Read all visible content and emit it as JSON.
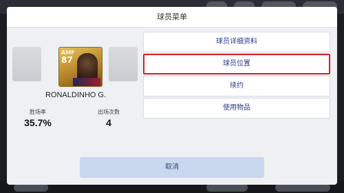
{
  "dialog": {
    "title": "球员菜单"
  },
  "player": {
    "name": "RONALDINHO G.",
    "card_position": "AMF",
    "card_rating": "87",
    "stats": [
      {
        "label": "胜场率",
        "value": "35.7%"
      },
      {
        "label": "出场次数",
        "value": "4"
      }
    ]
  },
  "menu": {
    "items": [
      {
        "label": "球员详细资料",
        "highlighted": false
      },
      {
        "label": "球员位置",
        "highlighted": true
      },
      {
        "label": "续约",
        "highlighted": false
      },
      {
        "label": "使用物品",
        "highlighted": false
      }
    ],
    "cancel_label": "取消"
  },
  "colors": {
    "highlight_border": "#d81d2a",
    "menu_text": "#2a3a8a",
    "cancel_bg": "#c9d8ee"
  }
}
